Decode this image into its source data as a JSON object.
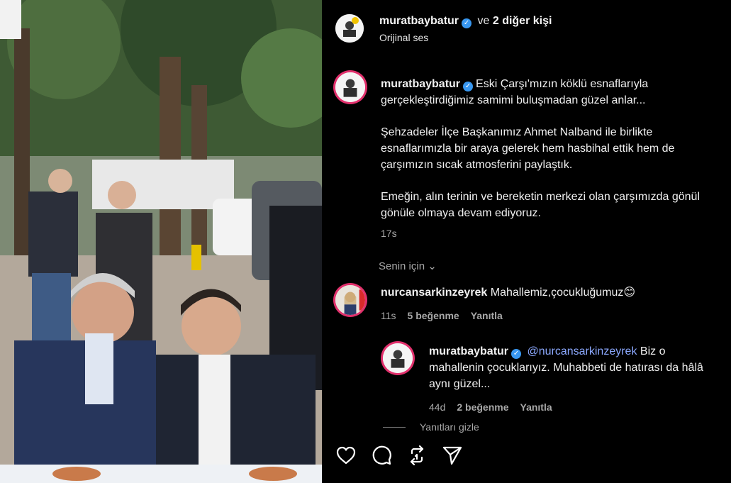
{
  "post_header": {
    "username": "muratbaybatur",
    "separator": "ve",
    "others": "2 diğer kişi",
    "audio": "Orijinal ses"
  },
  "caption": {
    "username": "muratbaybatur",
    "line1": "Eski Çarşı'mızın köklü esnaflarıyla gerçekleştirdiğimiz samimi buluşmadan güzel anlar...",
    "line2": "Şehzadeler İlçe Başkanımız Ahmet Nalband ile birlikte esnaflarımızla bir araya gelerek hem hasbihal ettik hem de çarşımızın sıcak atmosferini paylaştık.",
    "line3": "Emeğin, alın terinin ve bereketin merkezi olan çarşımızda gönül gönüle olmaya devam ediyoruz.",
    "time": "17s"
  },
  "comments_filter": "Senin için",
  "comments": [
    {
      "username": "nurcansarkinzeyrek",
      "text": "Mahallemiz,çocukluğumuz😊",
      "time": "11s",
      "likes": "5 beğenme",
      "reply": "Yanıtla"
    }
  ],
  "reply": {
    "username": "muratbaybatur",
    "mention": "@nurcansarkinzeyrek",
    "text": "Biz o mahallenin çocuklarıyız. Muhabbeti de hatırası da hâlâ aynı güzel...",
    "time": "44d",
    "likes": "2 beğenme",
    "reply": "Yanıtla"
  },
  "hide_replies": "Yanıtları gizle",
  "actions": [
    "heart-icon",
    "comment-icon",
    "repost-icon",
    "share-icon"
  ],
  "colors": {
    "background": "#000000",
    "verified": "#3897f0",
    "mention": "#8ca9ff",
    "story_ring": "#e1306c"
  }
}
